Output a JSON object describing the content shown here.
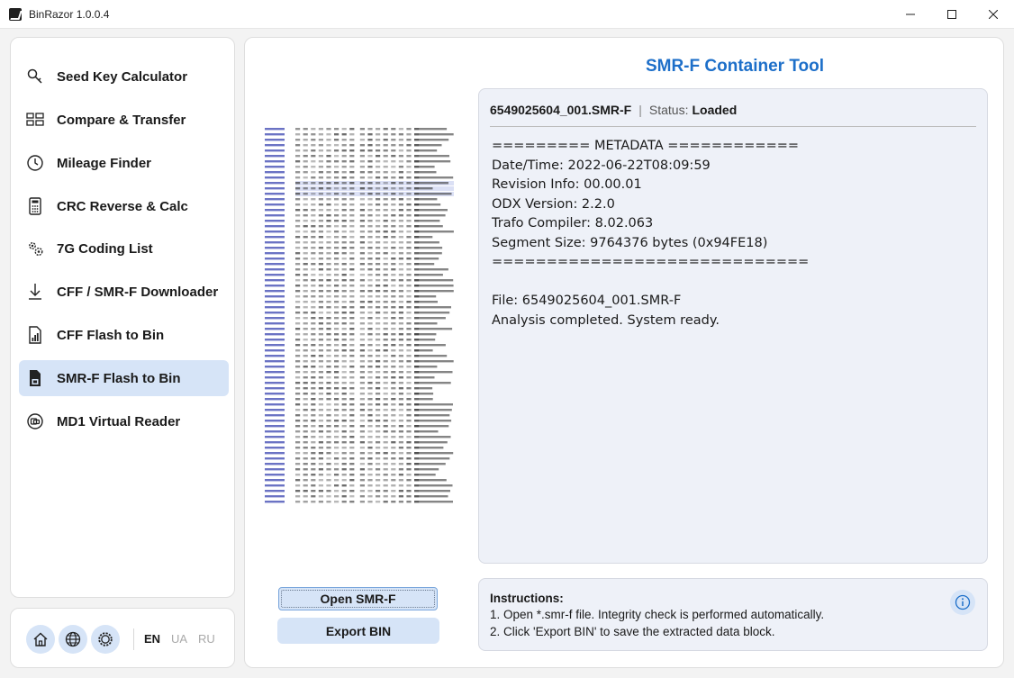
{
  "window": {
    "title": "BinRazor 1.0.0.4"
  },
  "sidebar": {
    "items": [
      {
        "label": "Seed Key Calculator",
        "icon": "key-icon"
      },
      {
        "label": "Compare & Transfer",
        "icon": "compare-icon"
      },
      {
        "label": "Mileage Finder",
        "icon": "clock-icon"
      },
      {
        "label": "CRC Reverse & Calc",
        "icon": "calculator-icon"
      },
      {
        "label": "7G Coding List",
        "icon": "gears-icon"
      },
      {
        "label": "CFF / SMR-F Downloader",
        "icon": "download-icon"
      },
      {
        "label": "CFF Flash to Bin",
        "icon": "chart-file-icon"
      },
      {
        "label": "SMR-F Flash to Bin",
        "icon": "file-save-icon",
        "active": true
      },
      {
        "label": "MD1 Virtual Reader",
        "icon": "chip-icon"
      }
    ]
  },
  "bottombar": {
    "languages": [
      "EN",
      "UA",
      "RU"
    ],
    "active_language": "EN"
  },
  "main": {
    "title": "SMR-F Container Tool",
    "file_name": "6549025604_001.SMR-F",
    "status_label": "Status:",
    "status_value": "Loaded",
    "log_lines": [
      "========= METADATA ============",
      "Date/Time: 2022-06-22T08:09:59",
      "Revision Info: 00.00.01",
      "ODX Version: 2.2.0",
      "Trafo Compiler: 8.02.063",
      "Segment Size: 9764376 bytes (0x94FE18)",
      "=============================",
      "",
      "File: 6549025604_001.SMR-F",
      "Analysis completed. System ready."
    ],
    "open_button": "Open SMR-F",
    "export_button": "Export BIN",
    "instructions": {
      "title": "Instructions:",
      "lines": [
        "1. Open *.smr-f file. Integrity check is performed automatically.",
        "2. Click 'Export BIN' to save the extracted data block."
      ]
    }
  },
  "colors": {
    "accent": "#1d6fc9",
    "selection": "#d6e4f7",
    "panel": "#eef1f8"
  }
}
